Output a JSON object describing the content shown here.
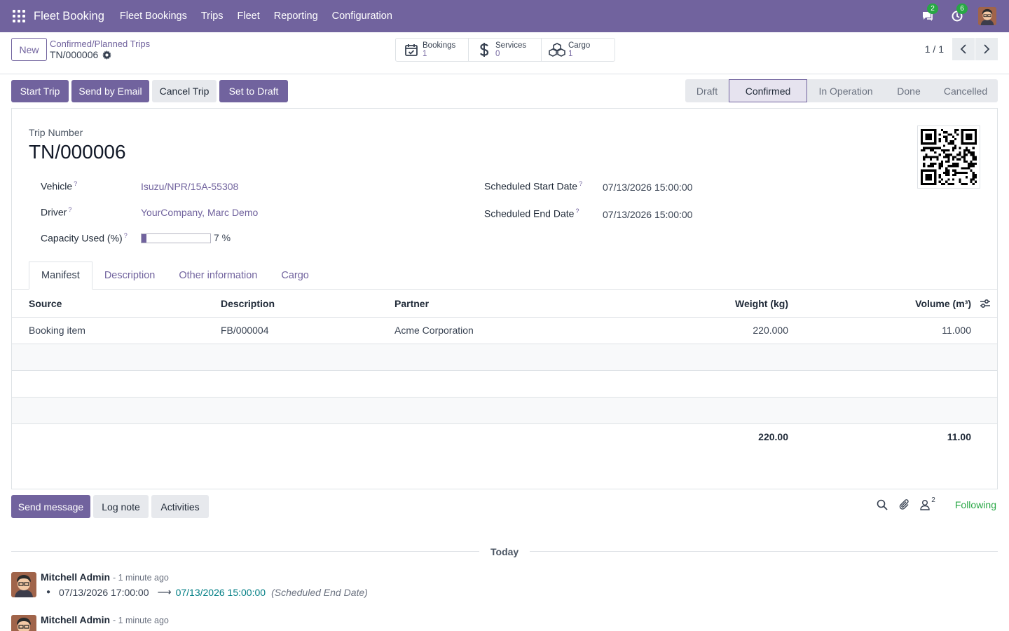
{
  "navbar": {
    "app_name": "Fleet Booking",
    "menus": [
      "Fleet Bookings",
      "Trips",
      "Fleet",
      "Reporting",
      "Configuration"
    ],
    "messages_badge": "2",
    "activities_badge": "6"
  },
  "control_panel": {
    "new_label": "New",
    "breadcrumb_parent": "Confirmed/Planned Trips",
    "breadcrumb_current": "TN/000006",
    "smart_buttons": [
      {
        "label": "Bookings",
        "value": "1",
        "icon": "calendar-check-icon"
      },
      {
        "label": "Services",
        "value": "0",
        "icon": "dollar-icon"
      },
      {
        "label": "Cargo",
        "value": "1",
        "icon": "cubes-icon"
      }
    ],
    "pager": "1 / 1"
  },
  "actions": {
    "start_trip": "Start Trip",
    "send_email": "Send by Email",
    "cancel_trip": "Cancel Trip",
    "set_draft": "Set to Draft"
  },
  "statusbar": [
    "Draft",
    "Confirmed",
    "In Operation",
    "Done",
    "Cancelled"
  ],
  "status_active": "Confirmed",
  "form": {
    "trip_number_label": "Trip Number",
    "trip_number": "TN/000006",
    "vehicle_label": "Vehicle",
    "vehicle": "Isuzu/NPR/15A-55308",
    "driver_label": "Driver",
    "driver": "YourCompany, Marc Demo",
    "capacity_label": "Capacity Used (%)",
    "capacity_value": 7,
    "capacity_text": "7 %",
    "start_label": "Scheduled Start Date",
    "start_date": "07/13/2026 15:00:00",
    "end_label": "Scheduled End Date",
    "end_date": "07/13/2026 15:00:00",
    "help_mark": "?"
  },
  "tabs": [
    "Manifest",
    "Description",
    "Other information",
    "Cargo"
  ],
  "manifest": {
    "columns": [
      "Source",
      "Description",
      "Partner",
      "Weight (kg)",
      "Volume (m³)"
    ],
    "rows": [
      {
        "source": "Booking item",
        "description": "FB/000004",
        "partner": "Acme Corporation",
        "weight": "220.000",
        "volume": "11.000"
      }
    ],
    "total_weight": "220.00",
    "total_volume": "11.00"
  },
  "chatter": {
    "send_message": "Send message",
    "log_note": "Log note",
    "activities": "Activities",
    "followers_count": "2",
    "following": "Following",
    "today": "Today",
    "messages": [
      {
        "author": "Mitchell Admin",
        "time": "- 1 minute ago",
        "old_value": "07/13/2026 17:00:00",
        "arrow": "⟶",
        "new_value": "07/13/2026 15:00:00",
        "field": "(Scheduled End Date)"
      },
      {
        "author": "Mitchell Admin",
        "time": "- 1 minute ago"
      }
    ]
  },
  "colors": {
    "primary": "#71639e",
    "success": "#28a745",
    "link_teal": "#017e84"
  }
}
